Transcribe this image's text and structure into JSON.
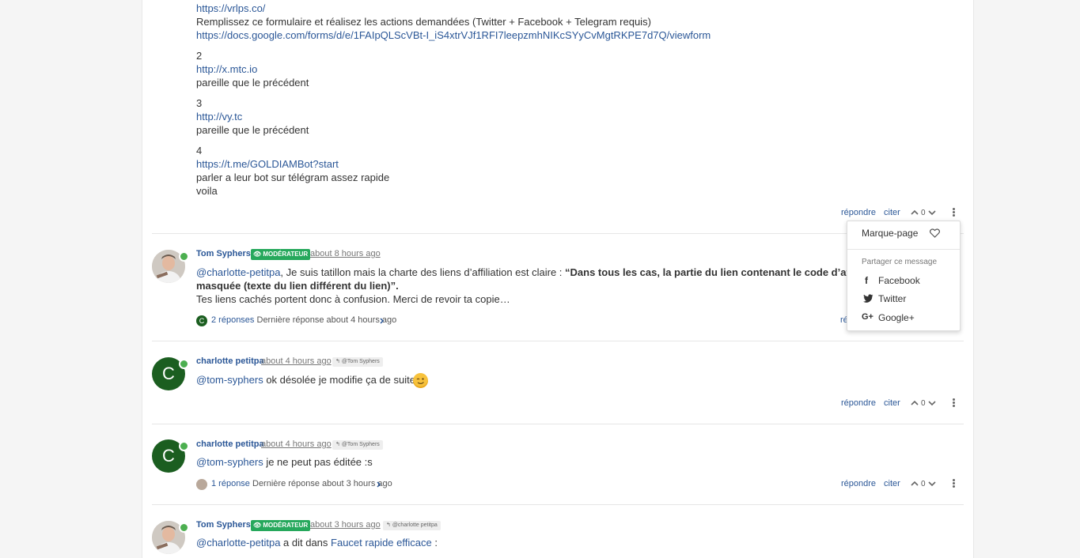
{
  "post1": {
    "link1": "https://vrlps.co/",
    "line_form": "Remplissez ce formulaire et réalisez les actions demandées (Twitter + Facebook + Telegram requis)",
    "link_form": "https://docs.google.com/forms/d/e/1FAIpQLScVBt-I_iS4xtrVJf1RFI7leepzmhNIKcSYyCvMgtRKPE7d7Q/viewform",
    "n2": "2",
    "link2": "http://x.mtc.io",
    "same2": "pareille que le précédent",
    "n3": "3",
    "link3": "http://vy.tc",
    "same3": "pareille que le précédent",
    "n4": "4",
    "link4": "https://t.me/GOLDIAMBot?start",
    "line4": "parler a leur bot sur télégram assez rapide",
    "voila": "voila",
    "reply": "répondre",
    "quote": "citer",
    "votes": "0"
  },
  "dropdown": {
    "bookmark": "Marque-page",
    "share_header": "Partager ce message",
    "facebook": "Facebook",
    "twitter": "Twitter",
    "google": "Google+",
    "hidden_reply": "ré"
  },
  "post2": {
    "author": "Tom Syphers",
    "badge": "MODÉRATEUR",
    "time": "about 8 hours ago",
    "mention": "@charlotte-petitpa",
    "text1": ", Je suis tatillon mais la charte des liens d’affiliation est claire : ",
    "bold1": "“Dans tous les cas, la partie du lien contenant le code d’affiliatio",
    "bold2": "masquée (texte du lien différent du lien)”.",
    "text2": "Tes liens cachés portent donc à confusion. Merci de revoir ta copie…",
    "replies_avatar": "C",
    "replies": "2 réponses",
    "last_reply": "Dernière réponse about 4 hours ago"
  },
  "post3": {
    "avatar": "C",
    "author": "charlotte petitpa",
    "time": "about 4 hours ago",
    "reply_to": "@Tom Syphers",
    "mention": "@tom-syphers",
    "text": " ok désolée je modifie ça de suite",
    "reply": "répondre",
    "quote": "citer",
    "votes": "0"
  },
  "post4": {
    "avatar": "C",
    "author": "charlotte petitpa",
    "time": "about 4 hours ago",
    "reply_to": "@Tom Syphers",
    "mention": "@tom-syphers",
    "text": " je ne peut pas éditée :s",
    "replies": "1 réponse",
    "last_reply": "Dernière réponse about 3 hours ago",
    "reply": "répondre",
    "quote": "citer",
    "votes": "0"
  },
  "post5": {
    "author": "Tom Syphers",
    "badge": "MODÉRATEUR",
    "time": "about 3 hours ago",
    "reply_to": "@charlotte petitpa",
    "mention": "@charlotte-petitpa",
    "text": " a dit dans ",
    "topic_link": "Faucet rapide efficace",
    "colon": " :"
  },
  "icons": {
    "upvote": "chevron-up-icon",
    "downvote": "chevron-down-icon",
    "menu": "kebab-menu-icon",
    "reply_arrow": "reply-arrow-icon",
    "heart": "heart-icon",
    "facebook": "facebook-icon",
    "twitter": "twitter-icon",
    "google": "google-plus-icon",
    "eye": "eye-icon"
  },
  "colors": {
    "link": "#2b5797",
    "moderator_badge": "#26a85c",
    "online": "#4caf50",
    "letter_avatar": "#1b5e20"
  }
}
